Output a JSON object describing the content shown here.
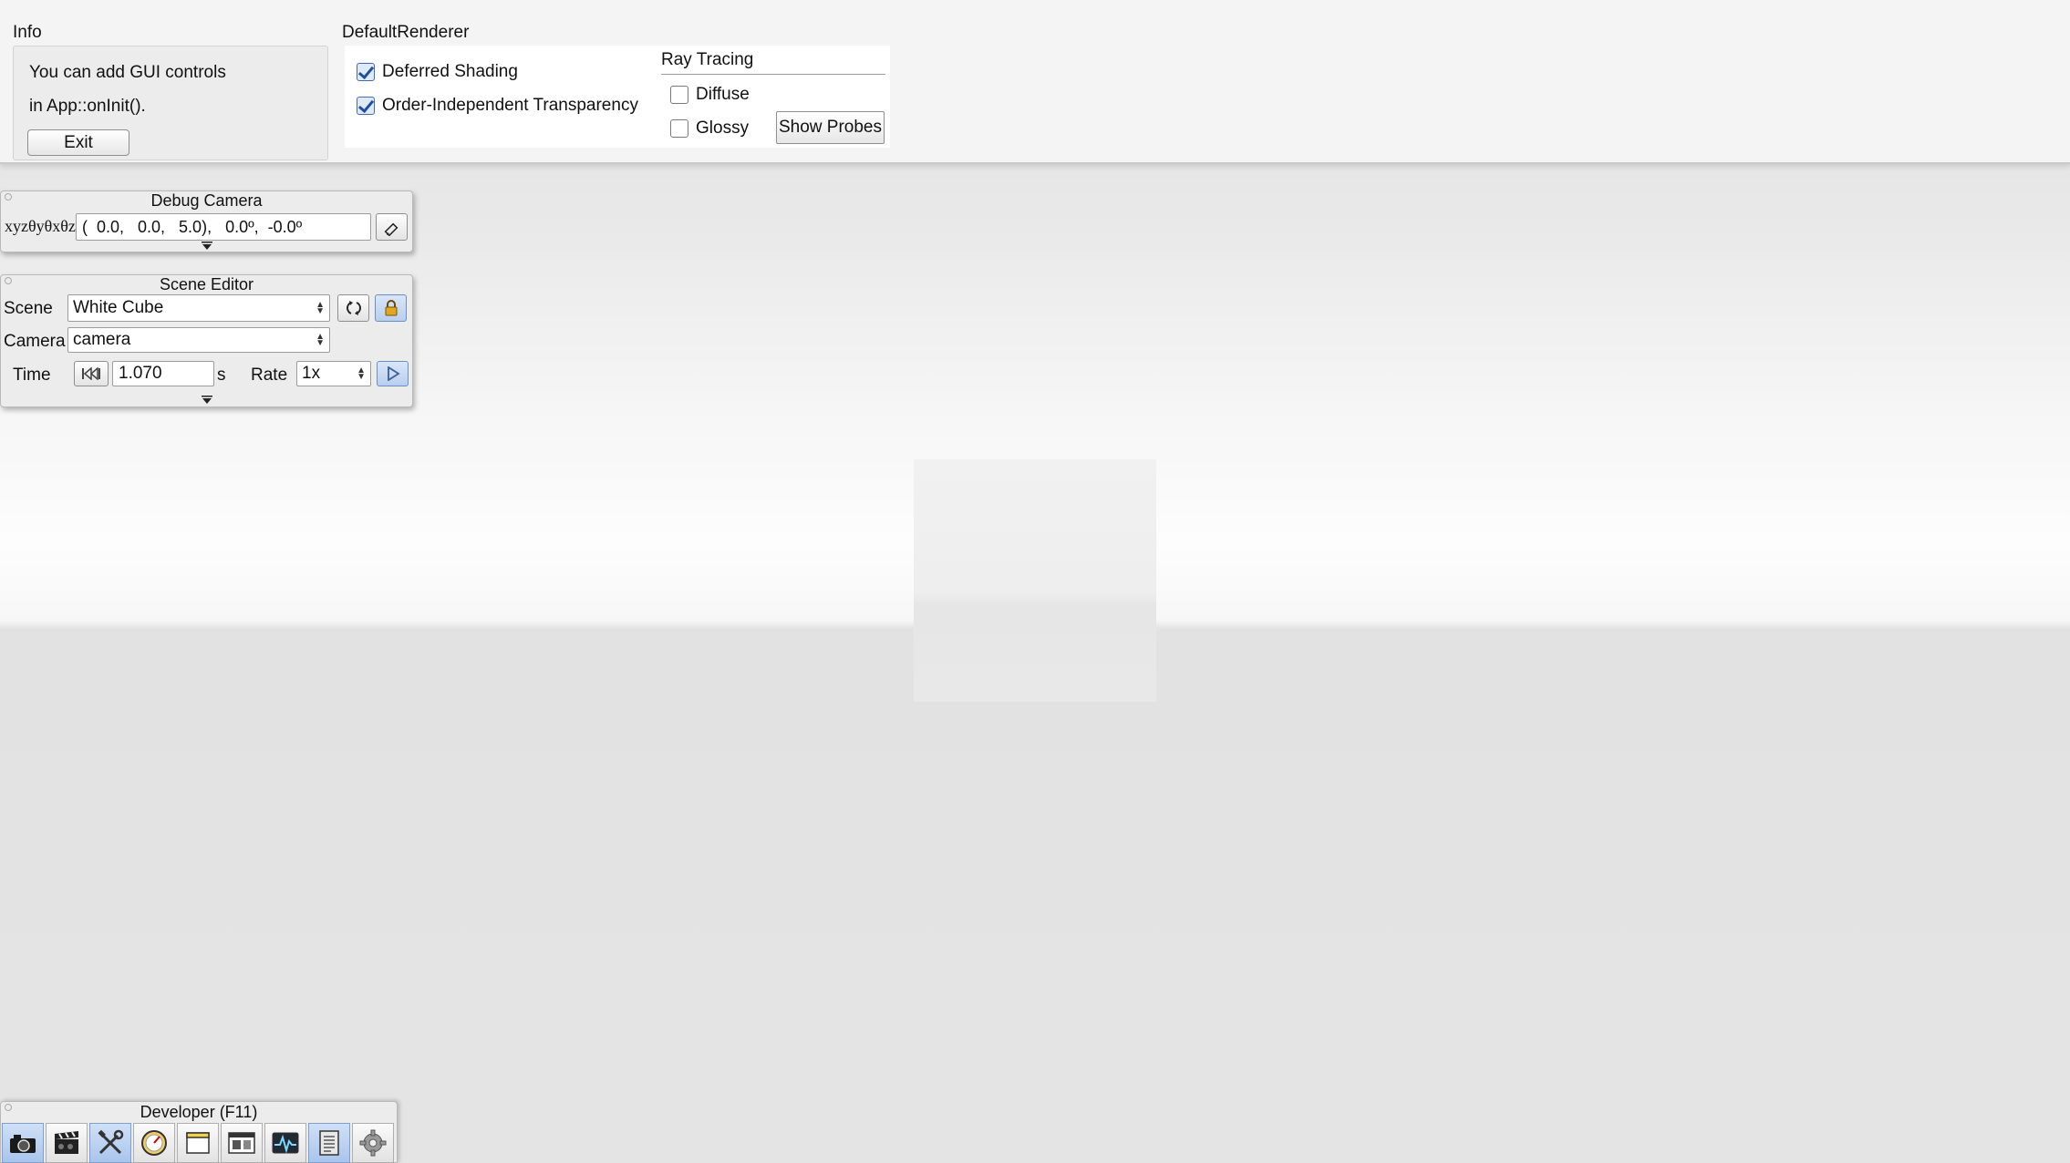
{
  "info": {
    "title": "Info",
    "line1": "You can add GUI controls",
    "line2": "in App::onInit().",
    "exit_label": "Exit"
  },
  "renderer": {
    "title": "DefaultRenderer",
    "deferred_label": "Deferred Shading",
    "deferred_checked": true,
    "oit_label": "Order-Independent Transparency",
    "oit_checked": true,
    "ray_tracing": {
      "title": "Ray Tracing",
      "diffuse_label": "Diffuse",
      "diffuse_checked": false,
      "glossy_label": "Glossy",
      "glossy_checked": false,
      "show_probes_label": "Show Probes"
    }
  },
  "debug_camera": {
    "title": "Debug Camera",
    "coord_label": "xyzθyθxθz",
    "value": "(  0.0,   0.0,   5.0),   0.0º,  -0.0º",
    "edit_icon": "pencil-icon"
  },
  "scene_editor": {
    "title": "Scene Editor",
    "scene_label": "Scene",
    "scene_value": "White Cube",
    "camera_label": "Camera",
    "camera_value": "camera",
    "time_label": "Time",
    "time_value": "1.070",
    "time_unit": "s",
    "rate_label": "Rate",
    "rate_value": "1x",
    "reload_icon": "reload-icon",
    "lock_icon": "lock-icon",
    "rewind_icon": "rewind-icon",
    "play_icon": "play-icon"
  },
  "developer": {
    "title": "Developer (F11)",
    "tools": [
      {
        "icon": "camera-icon",
        "active": true
      },
      {
        "icon": "clapperboard-icon",
        "active": false
      },
      {
        "icon": "tools-icon",
        "active": true
      },
      {
        "icon": "speedometer-icon",
        "active": false
      },
      {
        "icon": "window-icon",
        "active": false
      },
      {
        "icon": "scene-window-icon",
        "active": false
      },
      {
        "icon": "profiler-icon",
        "active": false
      },
      {
        "icon": "log-icon",
        "active": true
      },
      {
        "icon": "settings-gear-icon",
        "active": false
      }
    ]
  },
  "colors": {
    "accent": "#3d6db5",
    "active_button": "#b9cfee",
    "panel_bg": "#ececec"
  }
}
